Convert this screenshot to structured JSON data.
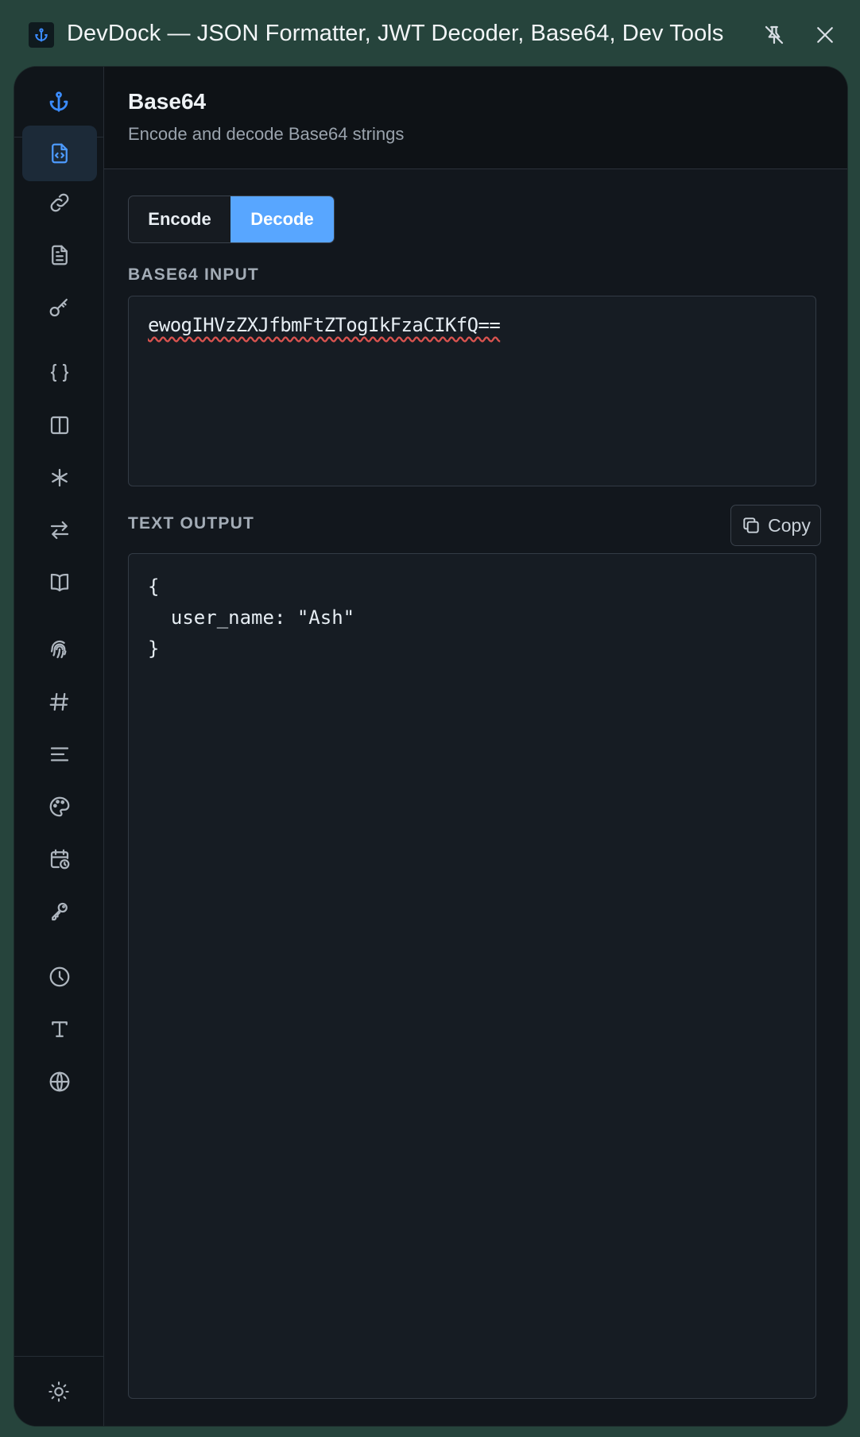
{
  "window": {
    "title": "DevDock — JSON Formatter, JWT Decoder, Base64, Dev Tools",
    "app_icon": "anchor-icon"
  },
  "titlebar_buttons": [
    "pin-off-icon",
    "close-icon"
  ],
  "sidebar": {
    "logo": "anchor-icon",
    "active_item": "base64-icon",
    "items": [
      {
        "icon": "file-code-icon",
        "active": true
      },
      {
        "icon": "link-icon"
      },
      {
        "icon": "document-icon"
      },
      {
        "icon": "key-icon"
      },
      {
        "icon": "braces-icon"
      },
      {
        "icon": "split-view-icon"
      },
      {
        "icon": "asterisk-icon"
      },
      {
        "icon": "swap-arrows-icon"
      },
      {
        "icon": "book-icon"
      },
      {
        "icon": "fingerprint-icon"
      },
      {
        "icon": "hash-icon"
      },
      {
        "icon": "align-lines-icon"
      },
      {
        "icon": "palette-icon"
      },
      {
        "icon": "calendar-clock-icon"
      },
      {
        "icon": "key-alt-icon"
      },
      {
        "icon": "clock-icon"
      },
      {
        "icon": "type-icon"
      },
      {
        "icon": "globe-icon"
      }
    ],
    "bottom_icon": "sun-icon"
  },
  "header": {
    "title": "Base64",
    "subtitle": "Encode and decode Base64 strings"
  },
  "mode": {
    "encode_label": "Encode",
    "decode_label": "Decode",
    "selected": "Decode"
  },
  "input": {
    "label": "BASE64 INPUT",
    "value": "ewogIHVzZXJfbmFtZTogIkFzaCIKfQ=="
  },
  "output": {
    "label": "TEXT OUTPUT",
    "copy_label": "Copy",
    "value": "{\n  user_name: \"Ash\"\n}"
  },
  "colors": {
    "accent": "#58a6ff",
    "frame": "#26443c",
    "background": "#12171d"
  }
}
